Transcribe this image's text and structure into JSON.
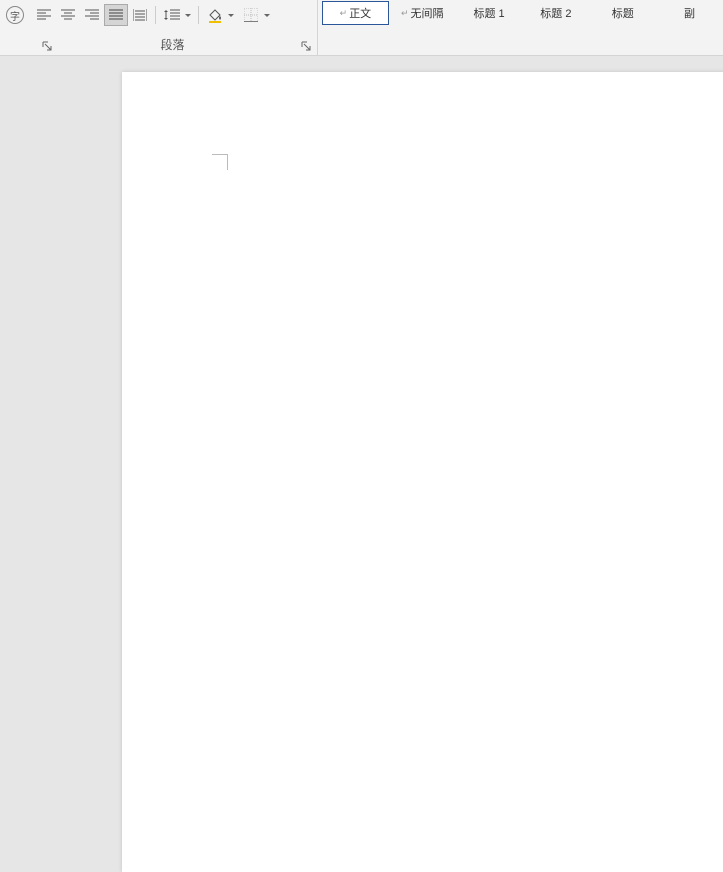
{
  "ribbon": {
    "font_launcher": "字",
    "paragraph_group_label": "段落",
    "styles": [
      {
        "para_mark": "↵",
        "label": "正文",
        "selected": true
      },
      {
        "para_mark": "↵",
        "label": "无间隔",
        "selected": false
      },
      {
        "para_mark": "",
        "label": "标题 1",
        "selected": false
      },
      {
        "para_mark": "",
        "label": "标题 2",
        "selected": false
      },
      {
        "para_mark": "",
        "label": "标题",
        "selected": false
      },
      {
        "para_mark": "",
        "label": "副",
        "selected": false
      }
    ]
  }
}
